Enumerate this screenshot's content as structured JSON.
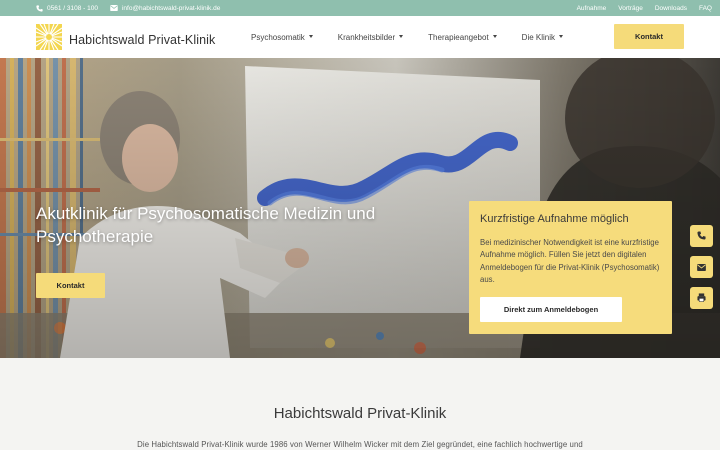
{
  "topbar": {
    "phone": "0561 / 3108 - 100",
    "email": "info@habichtswald-privat-klinik.de",
    "links": [
      "Aufnahme",
      "Vorträge",
      "Downloads",
      "FAQ"
    ],
    "phone_icon": "phone-icon",
    "email_icon": "mail-icon",
    "bg_color": "#8fbfae"
  },
  "header": {
    "logo_text": "Habichtswald Privat-Klinik",
    "logo_icon": "sun-rays-logo",
    "nav": [
      "Psychosomatik",
      "Krankheitsbilder",
      "Therapieangebot",
      "Die Klinik"
    ],
    "contact_label": "Kontakt",
    "accent_color": "#f5db7a"
  },
  "hero": {
    "title": "Akutklinik für Psychosomatische Medizin und Psychotherapie",
    "button_label": "Kontakt",
    "card": {
      "title": "Kurzfristige Aufnahme möglich",
      "text": "Bei medizinischer Notwendigkeit ist eine kurzfristige Aufnahme möglich. Füllen Sie jetzt den digitalen Anmeldebogen für die Privat-Klinik (Psychosomatik) aus.",
      "button_label": "Direkt zum Anmeldebogen"
    }
  },
  "side_buttons": [
    "phone-icon",
    "mail-icon",
    "fax-icon"
  ],
  "intro": {
    "title": "Habichtswald Privat-Klinik",
    "text": "Die Habichtswald Privat-Klinik wurde 1986 von Werner Wilhelm Wicker mit dem Ziel gegründet, eine fachlich hochwertige und"
  }
}
